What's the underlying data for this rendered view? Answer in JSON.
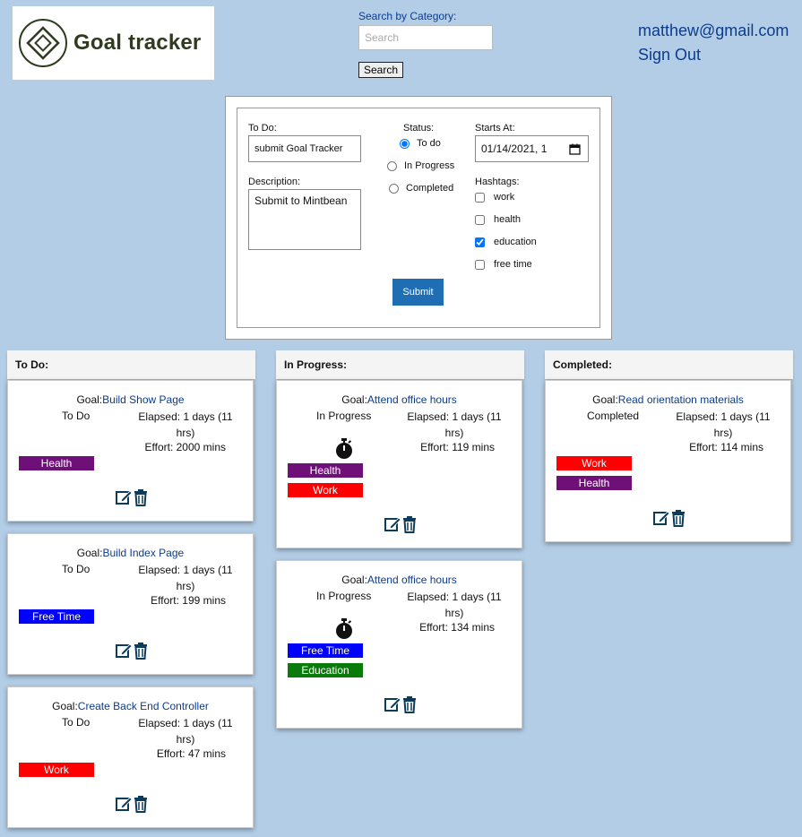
{
  "header": {
    "logo_text": "Goal tracker",
    "search_label": "Search by Category:",
    "search_placeholder": "Search",
    "search_button": "Search",
    "user_email": "matthew@gmail.com",
    "sign_out": "Sign Out"
  },
  "form": {
    "todo_label": "To Do:",
    "todo_value": "submit Goal Tracker",
    "description_label": "Description:",
    "description_value": "Submit to Mintbean",
    "status_label": "Status:",
    "status_options": [
      "To do",
      "In Progress",
      "Completed"
    ],
    "status_selected": "To do",
    "starts_label": "Starts At:",
    "starts_value": "01/14/2021, 1",
    "hashtags_label": "Hashtags:",
    "hashtags": [
      {
        "label": "work",
        "checked": false
      },
      {
        "label": "health",
        "checked": false
      },
      {
        "label": "education",
        "checked": true
      },
      {
        "label": "free time",
        "checked": false
      }
    ],
    "submit_label": "Submit"
  },
  "columns": [
    {
      "title": "To Do:",
      "cards": [
        {
          "goal_prefix": "Goal:",
          "goal": "Build Show Page",
          "status": "To Do",
          "elapsed": "Elapsed: 1 days (11 hrs)",
          "effort": "Effort: 2000 mins",
          "tags": [
            "Health"
          ]
        },
        {
          "goal_prefix": "Goal:",
          "goal": "Build Index Page",
          "status": "To Do",
          "elapsed": "Elapsed: 1 days (11 hrs)",
          "effort": "Effort: 199 mins",
          "tags": [
            "Free Time"
          ]
        },
        {
          "goal_prefix": "Goal:",
          "goal": "Create Back End Controller",
          "status": "To Do",
          "elapsed": "Elapsed: 1 days (11 hrs)",
          "effort": "Effort: 47 mins",
          "tags": [
            "Work"
          ]
        }
      ]
    },
    {
      "title": "In Progress:",
      "cards": [
        {
          "goal_prefix": "Goal:",
          "goal": "Attend office hours",
          "status": "In Progress",
          "elapsed": "Elapsed: 1 days (11 hrs)",
          "effort": "Effort: 119 mins",
          "tags": [
            "Health",
            "Work"
          ]
        },
        {
          "goal_prefix": "Goal:",
          "goal": "Attend office hours",
          "status": "In Progress",
          "elapsed": "Elapsed: 1 days (11 hrs)",
          "effort": "Effort: 134 mins",
          "tags": [
            "Free Time",
            "Education"
          ]
        }
      ]
    },
    {
      "title": "Completed:",
      "cards": [
        {
          "goal_prefix": "Goal:",
          "goal": "Read orientation materials",
          "status": "Completed",
          "elapsed": "Elapsed: 1 days (11 hrs)",
          "effort": "Effort: 114 mins",
          "tags": [
            "Work",
            "Health"
          ]
        }
      ]
    }
  ],
  "tag_colors": {
    "Health": "#6f0f78",
    "Work": "#ff0000",
    "Free Time": "#0000ff",
    "Education": "#0a7a0a"
  },
  "icons": {
    "edit": "edit-icon",
    "delete": "trash-icon",
    "timer": "stopwatch-icon",
    "calendar": "calendar-icon"
  }
}
